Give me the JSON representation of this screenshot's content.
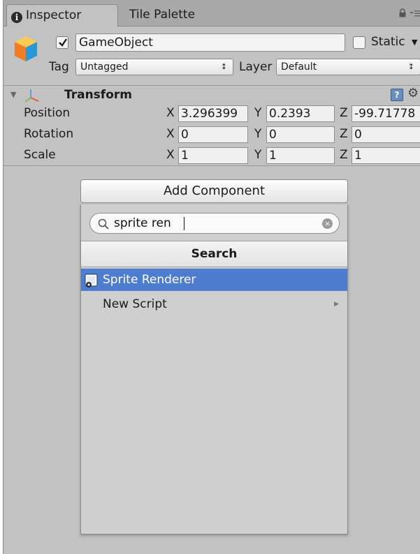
{
  "tabs": [
    {
      "label": "Inspector"
    },
    {
      "label": "Tile Palette"
    }
  ],
  "gameobject": {
    "name": "GameObject",
    "active": true,
    "static_label": "Static",
    "tag_label": "Tag",
    "tag_value": "Untagged",
    "layer_label": "Layer",
    "layer_value": "Default"
  },
  "transform": {
    "title": "Transform",
    "rows": [
      {
        "label": "Position",
        "x": "3.296399",
        "y": "0.2393",
        "z": "-99.71778"
      },
      {
        "label": "Rotation",
        "x": "0",
        "y": "0",
        "z": "0"
      },
      {
        "label": "Scale",
        "x": "1",
        "y": "1",
        "z": "1"
      }
    ],
    "axis_x": "X",
    "axis_y": "Y",
    "axis_z": "Z"
  },
  "add_component": {
    "button_label": "Add Component",
    "search_value": "sprite ren",
    "header": "Search",
    "results": [
      {
        "label": "Sprite Renderer",
        "selected": true
      },
      {
        "label": "New Script",
        "has_submenu": true
      }
    ]
  },
  "colors": {
    "selection": "#4e7dd0",
    "panel_bg": "#c2c2c2"
  }
}
